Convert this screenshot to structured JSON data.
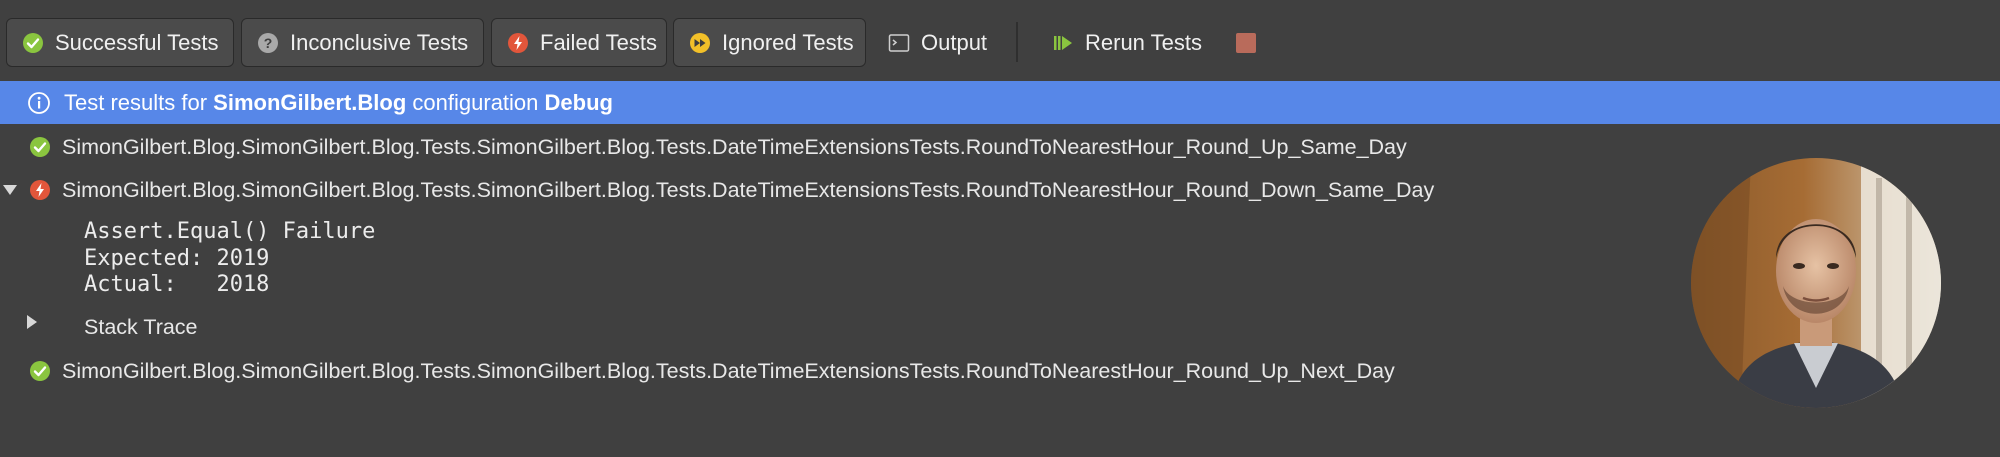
{
  "toolbar": {
    "successful_tests": "Successful Tests",
    "inconclusive_tests": "Inconclusive Tests",
    "failed_tests": "Failed Tests",
    "ignored_tests": "Ignored Tests",
    "output": "Output",
    "rerun_tests": "Rerun Tests"
  },
  "banner": {
    "prefix": "Test results for",
    "project": "SimonGilbert.Blog",
    "middle": "configuration",
    "configuration": "Debug"
  },
  "results": [
    {
      "status": "passed",
      "name": "SimonGilbert.Blog.SimonGilbert.Blog.Tests.SimonGilbert.Blog.Tests.DateTimeExtensionsTests.RoundToNearestHour_Round_Up_Same_Day"
    },
    {
      "status": "failed",
      "name": "SimonGilbert.Blog.SimonGilbert.Blog.Tests.SimonGilbert.Blog.Tests.DateTimeExtensionsTests.RoundToNearestHour_Round_Down_Same_Day"
    },
    {
      "status": "passed",
      "name": "SimonGilbert.Blog.SimonGilbert.Blog.Tests.SimonGilbert.Blog.Tests.DateTimeExtensionsTests.RoundToNearestHour_Round_Up_Next_Day"
    }
  ],
  "failure": {
    "line1": "Assert.Equal() Failure",
    "line2": "Expected: 2019",
    "line3": "Actual:   2018",
    "stack_trace": "Stack Trace"
  },
  "colors": {
    "background": "#404040",
    "banner": "#5787e8",
    "success": "#8ac53f",
    "failed": "#e2563b",
    "ignored": "#f2c029",
    "inconclusive": "#a9a9a9",
    "stop": "#b96b5b"
  },
  "icons": {
    "successful": "check-circle-icon",
    "inconclusive": "question-circle-icon",
    "failed": "lightning-circle-icon",
    "ignored": "fast-forward-circle-icon",
    "output": "terminal-icon",
    "rerun": "rerun-icon",
    "stop": "stop-icon",
    "info": "info-icon"
  }
}
